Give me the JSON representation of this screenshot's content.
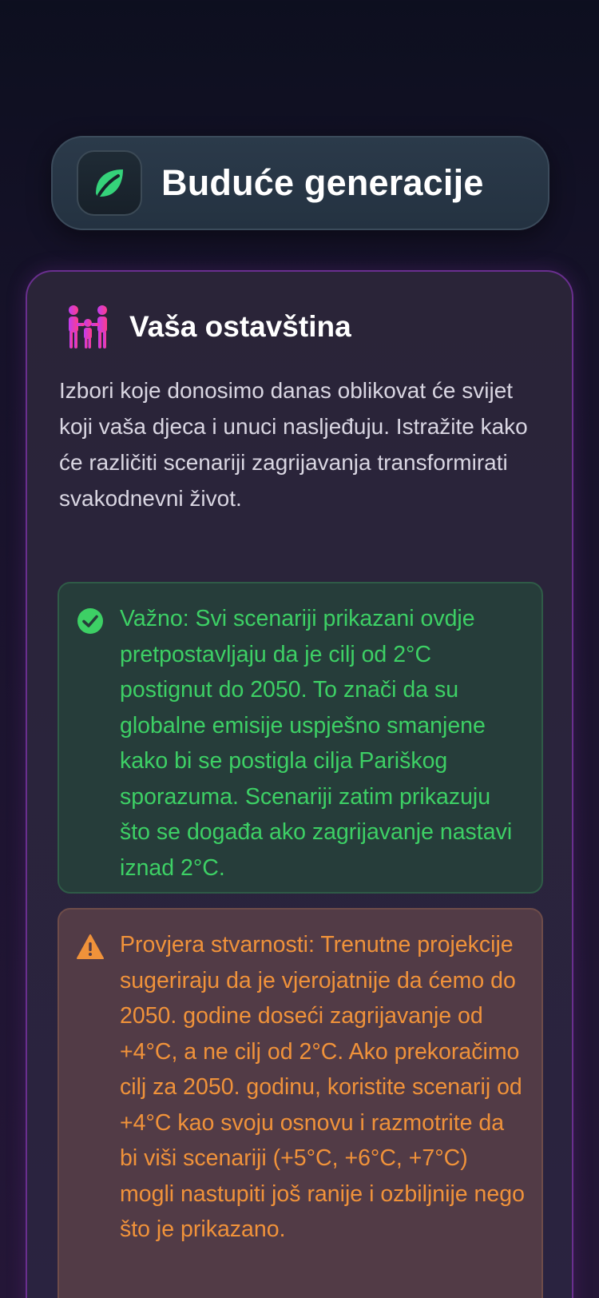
{
  "header": {
    "title": "Buduće generacije",
    "icon": "leaf-icon",
    "accent": "#35d27a"
  },
  "legacy": {
    "icon": "family-icon",
    "title": "Vaša ostavština",
    "intro": "Izbori koje donosimo danas oblikovat će svijet koji vaša djeca i unuci nasljeđuju. Istražite kako će različiti scenariji zagrijavanja transformirati svakodnevni život."
  },
  "notes": {
    "important": {
      "icon": "check-circle-icon",
      "color": "#3dd065",
      "text": "Važno: Svi scenariji prikazani ovdje pretpostavljaju da je cilj od 2°C postignut do 2050. To znači da su globalne emisije uspješno smanjene kako bi se postigla cilja Pariškog sporazuma. Scenariji zatim prikazuju što se događa ako zagrijavanje nastavi iznad 2°C."
    },
    "reality": {
      "icon": "warning-icon",
      "color": "#f0923a",
      "text": "Provjera stvarnosti: Trenutne projekcije sugeriraju da je vjerojatnije da ćemo do 2050. godine doseći zagrijavanje od +4°C, a ne cilj od 2°C. Ako prekoračimo cilj za 2050. godinu, koristite scenarij od +4°C kao svoju osnovu i razmotrite da bi viši scenariji (+5°C, +6°C, +7°C) mogli nastupiti još ranije i ozbiljnije nego što je prikazano."
    }
  }
}
